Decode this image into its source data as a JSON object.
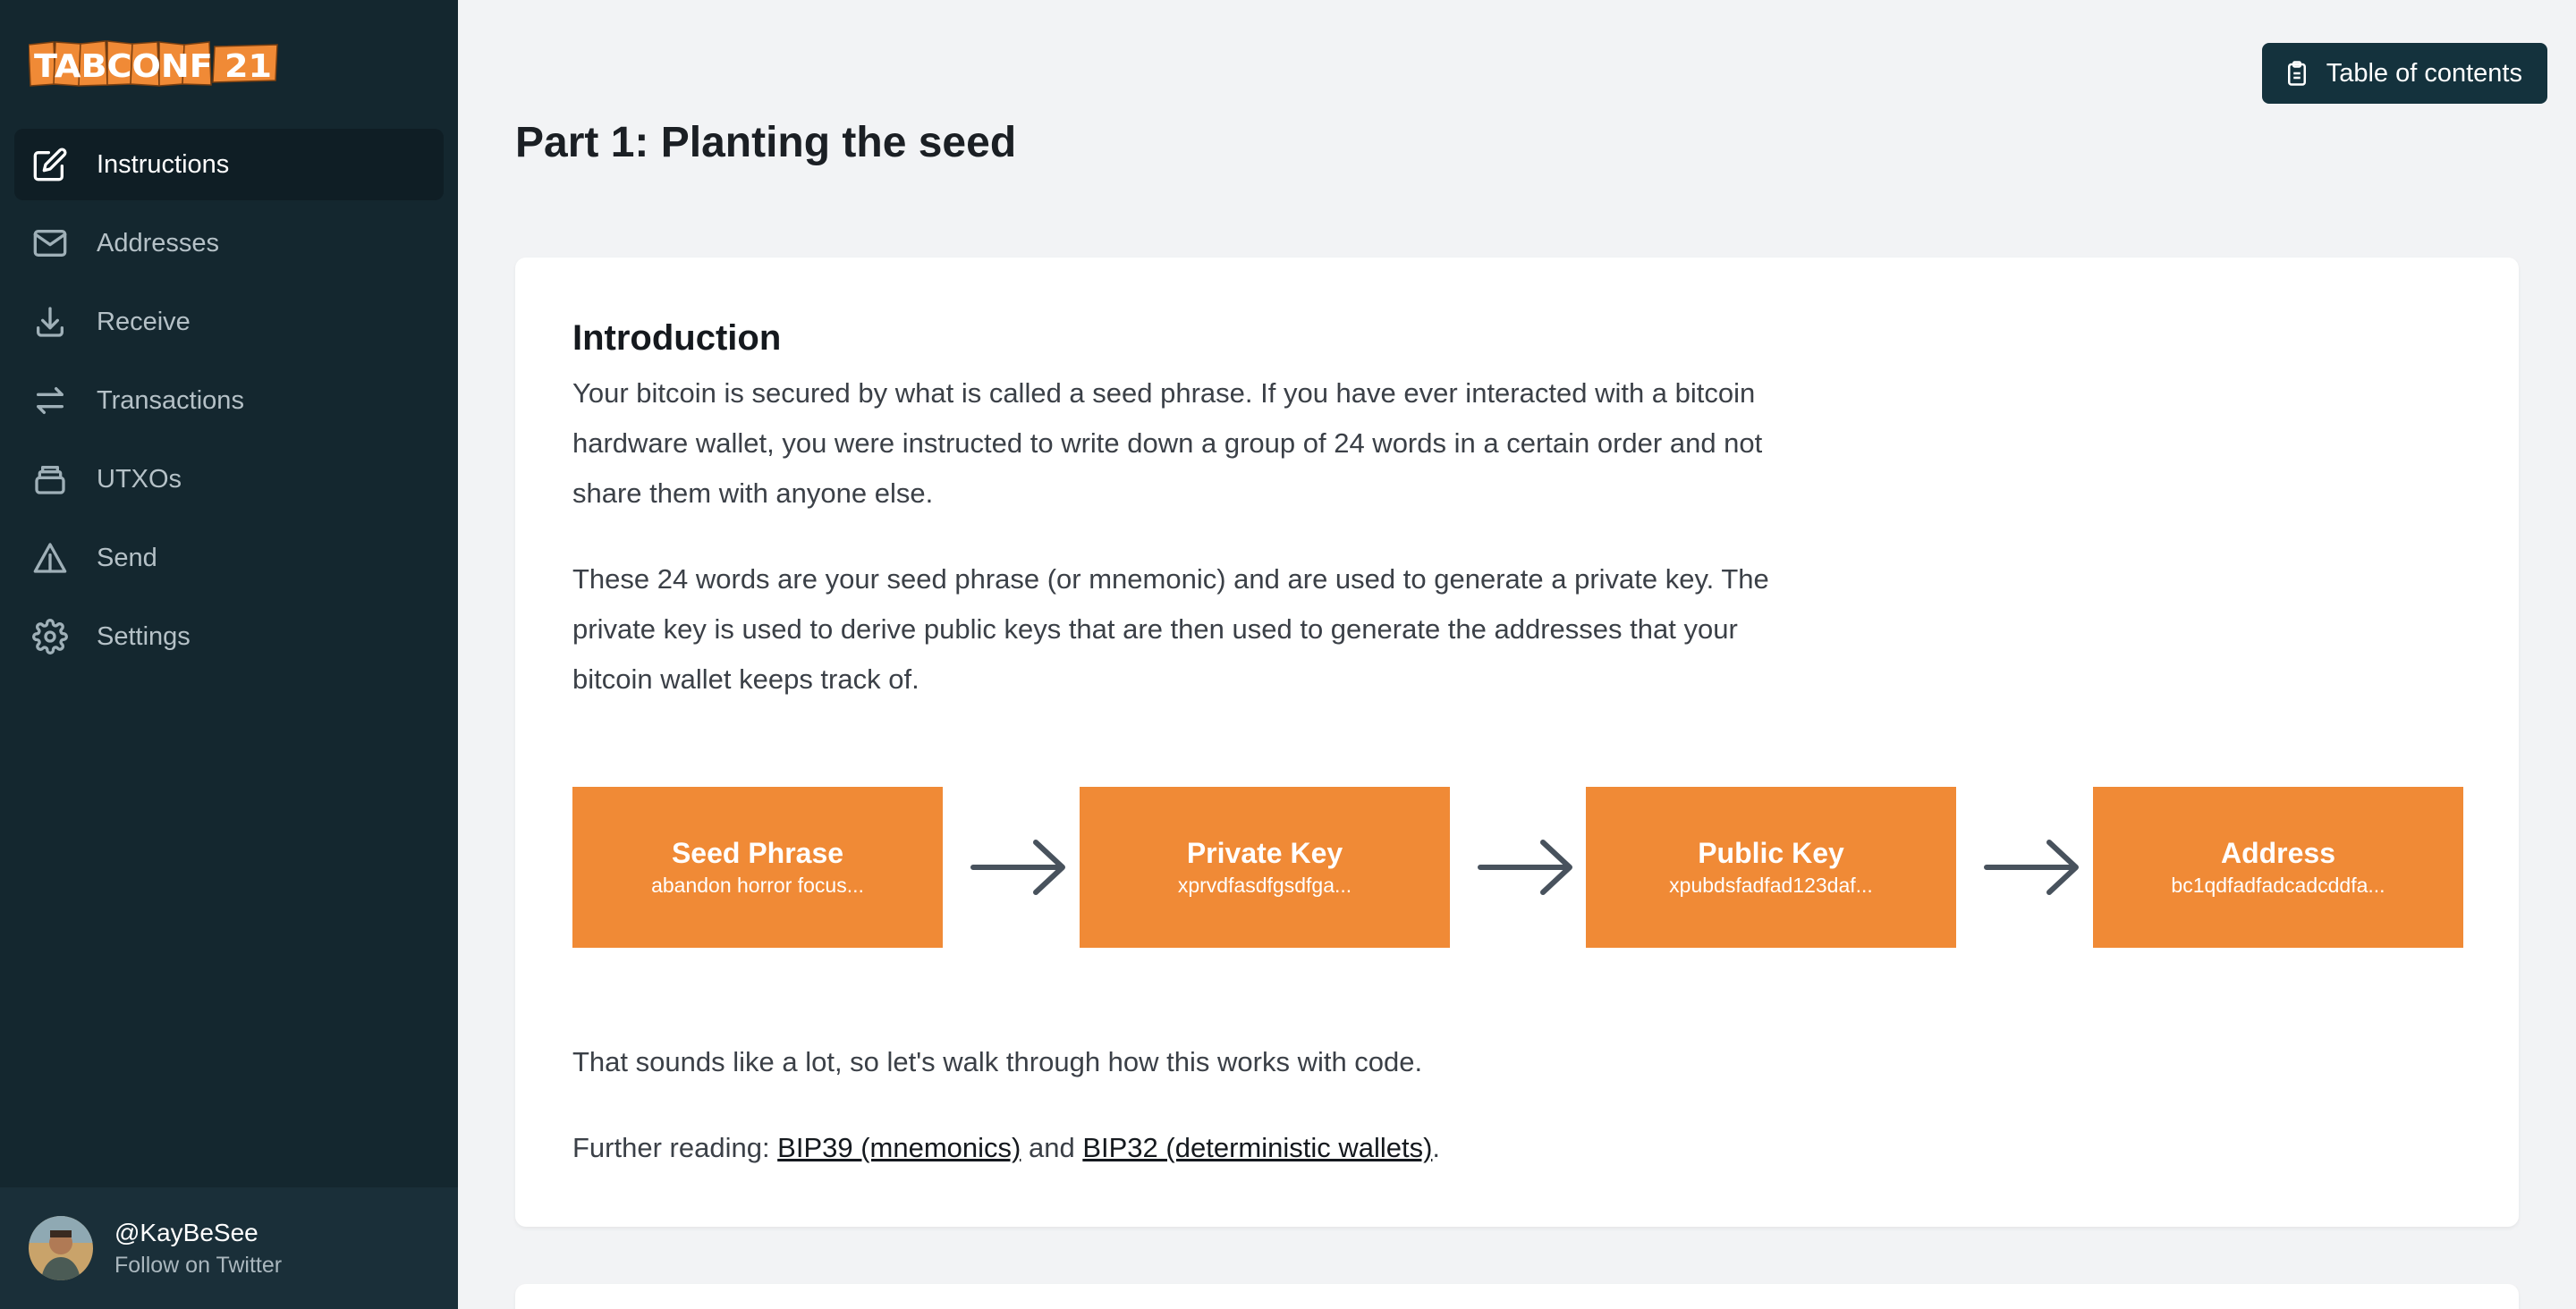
{
  "brand": {
    "logo_text": "TABCONF 21",
    "logo_color": "#f08a36"
  },
  "sidebar": {
    "items": [
      {
        "label": "Instructions",
        "icon": "pencil-square-icon",
        "active": true
      },
      {
        "label": "Addresses",
        "icon": "mail-icon",
        "active": false
      },
      {
        "label": "Receive",
        "icon": "download-icon",
        "active": false
      },
      {
        "label": "Transactions",
        "icon": "switch-arrows-icon",
        "active": false
      },
      {
        "label": "UTXOs",
        "icon": "archive-icon",
        "active": false
      },
      {
        "label": "Send",
        "icon": "warning-triangle-icon",
        "active": false
      },
      {
        "label": "Settings",
        "icon": "gear-icon",
        "active": false
      }
    ]
  },
  "profile": {
    "name": "@KayBeSee",
    "subtitle": "Follow on Twitter"
  },
  "header": {
    "toc_label": "Table of contents"
  },
  "page": {
    "title": "Part 1: Planting the seed"
  },
  "intro": {
    "title": "Introduction",
    "p1": "Your bitcoin is secured by what is called a seed phrase. If you have ever interacted with a bitcoin hardware wallet, you were instructed to write down a group of 24 words in a certain order and not share them with anyone else.",
    "p2": "These 24 words are your seed phrase (or mnemonic) and are used to generate a private key. The private key is used to derive public keys that are then used to generate the addresses that your bitcoin wallet keeps track of.",
    "p3": "That sounds like a lot, so let's walk through how this works with code.",
    "further_prefix": "Further reading: ",
    "link1": "BIP39 (mnemonics)",
    "and": " and ",
    "link2": "BIP32 (deterministic wallets)",
    "period": "."
  },
  "flow": [
    {
      "title": "Seed Phrase",
      "sub": "abandon horror focus..."
    },
    {
      "title": "Private Key",
      "sub": "xprvdfasdfgsdfga..."
    },
    {
      "title": "Public Key",
      "sub": "xpubdsfadfad123daf..."
    },
    {
      "title": "Address",
      "sub": "bc1qdfadfadcadcddfa..."
    }
  ],
  "colors": {
    "sidebar": "#14272f",
    "accent": "#f08a36",
    "toc_button": "#14323d"
  }
}
